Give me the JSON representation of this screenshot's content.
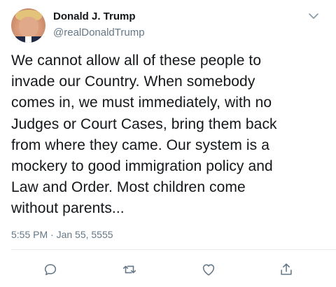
{
  "tweet": {
    "author": {
      "name": "Donald J. Trump",
      "handle": "@realDonaldTrump",
      "avatar_icon": "profile-photo"
    },
    "text_lines": [
      "We cannot allow all of these people to",
      "invade our Country. When somebody",
      "comes in, we must immediately, with no",
      "Judges or Court Cases, bring them back",
      "from where they came. Our system is a",
      "mockery to good immigration policy and",
      "Law and Order. Most children come",
      "without parents..."
    ],
    "timestamp": "5:55 PM · Jan 55, 5555",
    "menu_icon": "chevron-down-icon",
    "actions": [
      {
        "icon": "reply-icon"
      },
      {
        "icon": "retweet-icon"
      },
      {
        "icon": "like-icon"
      },
      {
        "icon": "share-icon"
      }
    ]
  },
  "colors": {
    "text": "#14171a",
    "secondary": "#657786",
    "divider": "#e6ecf0"
  }
}
